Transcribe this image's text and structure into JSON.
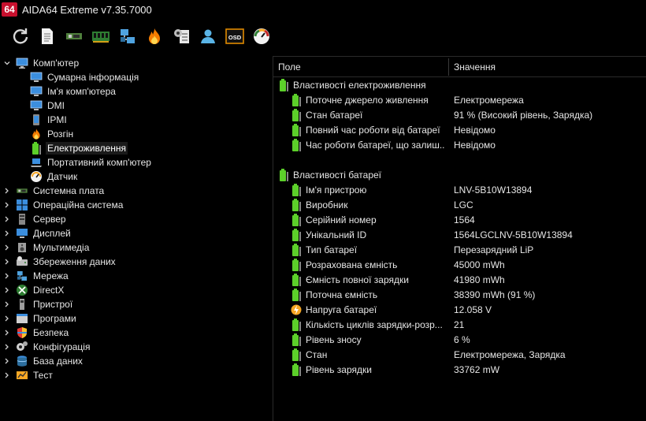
{
  "window": {
    "logo_text": "64",
    "title": "AIDA64 Extreme v7.35.7000"
  },
  "toolbar": {
    "buttons": [
      {
        "icon": "refresh-icon"
      },
      {
        "icon": "report-icon"
      },
      {
        "icon": "motherboard-icon"
      },
      {
        "icon": "memory-icon"
      },
      {
        "icon": "network-icon"
      },
      {
        "icon": "flame-icon"
      },
      {
        "icon": "settings-icon"
      },
      {
        "icon": "user-icon"
      },
      {
        "icon": "osd-icon",
        "text": "OSD"
      },
      {
        "icon": "gauge-icon"
      }
    ]
  },
  "tree": {
    "items": [
      {
        "label": "Комп'ютер",
        "expanded": true,
        "level": 0,
        "icon": "computer-icon"
      },
      {
        "label": "Сумарна інформація",
        "level": 1,
        "icon": "monitor-icon"
      },
      {
        "label": "Ім'я комп'ютера",
        "level": 1,
        "icon": "monitor-icon"
      },
      {
        "label": "DMI",
        "level": 1,
        "icon": "monitor-icon"
      },
      {
        "label": "IPMI",
        "level": 1,
        "icon": "phone-icon"
      },
      {
        "label": "Розгін",
        "level": 1,
        "icon": "flame-icon"
      },
      {
        "label": "Електроживлення",
        "level": 1,
        "icon": "battery-icon",
        "selected": true
      },
      {
        "label": "Портативний комп'ютер",
        "level": 1,
        "icon": "laptop-icon"
      },
      {
        "label": "Датчик",
        "level": 1,
        "icon": "sensor-icon"
      },
      {
        "label": "Системна плата",
        "level": 0,
        "icon": "motherboard-icon"
      },
      {
        "label": "Операційна система",
        "level": 0,
        "icon": "windows-icon"
      },
      {
        "label": "Сервер",
        "level": 0,
        "icon": "server-icon"
      },
      {
        "label": "Дисплей",
        "level": 0,
        "icon": "display-icon"
      },
      {
        "label": "Мультимедіа",
        "level": 0,
        "icon": "speaker-icon"
      },
      {
        "label": "Збереження даних",
        "level": 0,
        "icon": "storage-icon"
      },
      {
        "label": "Мережа",
        "level": 0,
        "icon": "network-icon"
      },
      {
        "label": "DirectX",
        "level": 0,
        "icon": "xbox-icon"
      },
      {
        "label": "Пристрої",
        "level": 0,
        "icon": "device-icon"
      },
      {
        "label": "Програми",
        "level": 0,
        "icon": "programs-icon"
      },
      {
        "label": "Безпека",
        "level": 0,
        "icon": "shield-icon"
      },
      {
        "label": "Конфігурація",
        "level": 0,
        "icon": "gear-icon"
      },
      {
        "label": "База даних",
        "level": 0,
        "icon": "database-icon"
      },
      {
        "label": "Тест",
        "level": 0,
        "icon": "benchmark-icon"
      }
    ]
  },
  "table": {
    "col_field": "Поле",
    "col_value": "Значення",
    "rows": [
      {
        "type": "group",
        "field": "Властивості електроживлення",
        "icon": "battery-icon"
      },
      {
        "type": "item",
        "field": "Поточне джерело живлення",
        "value": "Електромережа",
        "icon": "battery-icon"
      },
      {
        "type": "item",
        "field": "Стан батареї",
        "value": "91 % (Високий рівень, Зарядка)",
        "icon": "battery-icon"
      },
      {
        "type": "item",
        "field": "Повний час роботи від батареї",
        "value": "Невідомо",
        "icon": "battery-icon"
      },
      {
        "type": "item",
        "field": "Час роботи батареї, що залиш...",
        "value": "Невідомо",
        "icon": "battery-icon"
      },
      {
        "type": "blank"
      },
      {
        "type": "group",
        "field": "Властивості батареї",
        "icon": "battery-icon"
      },
      {
        "type": "item",
        "field": "Ім'я пристрою",
        "value": "LNV-5B10W13894",
        "icon": "battery-icon"
      },
      {
        "type": "item",
        "field": "Виробник",
        "value": "LGC",
        "icon": "battery-icon"
      },
      {
        "type": "item",
        "field": "Серійний номер",
        "value": "1564",
        "icon": "battery-icon"
      },
      {
        "type": "item",
        "field": "Унікальний ID",
        "value": "1564LGCLNV-5B10W13894",
        "icon": "battery-icon"
      },
      {
        "type": "item",
        "field": "Тип батареї",
        "value": "Перезарядний LiP",
        "icon": "battery-icon"
      },
      {
        "type": "item",
        "field": "Розрахована ємність",
        "value": "45000 mWh",
        "icon": "battery-icon"
      },
      {
        "type": "item",
        "field": "Ємність повної зарядки",
        "value": "41980 mWh",
        "icon": "battery-icon"
      },
      {
        "type": "item",
        "field": "Поточна ємність",
        "value": "38390 mWh  (91 %)",
        "icon": "battery-icon"
      },
      {
        "type": "item",
        "field": "Напруга батареї",
        "value": "12.058 V",
        "icon": "voltage-icon"
      },
      {
        "type": "item",
        "field": "Кількість циклів зарядки-розр...",
        "value": "21",
        "icon": "battery-icon"
      },
      {
        "type": "item",
        "field": "Рівень зносу",
        "value": "6 %",
        "icon": "battery-icon"
      },
      {
        "type": "item",
        "field": "Стан",
        "value": "Електромережа, Зарядка",
        "icon": "battery-icon"
      },
      {
        "type": "item",
        "field": "Рівень зарядки",
        "value": "33762 mW",
        "icon": "battery-icon"
      }
    ]
  },
  "colors": {
    "background": "#000000",
    "text": "#e6e6e6",
    "battery_green": "#5ccf2a",
    "logo_red": "#c8102e"
  }
}
